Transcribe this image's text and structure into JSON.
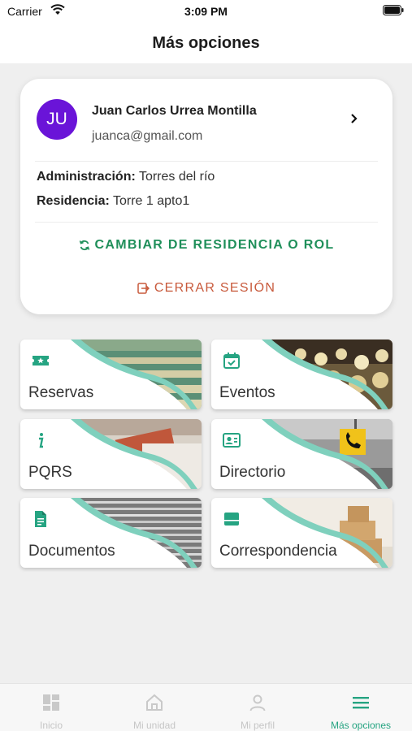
{
  "status_bar": {
    "carrier": "Carrier",
    "time": "3:09 PM"
  },
  "header": {
    "title": "Más opciones"
  },
  "profile": {
    "avatar_initials": "JU",
    "name": "Juan Carlos Urrea Montilla",
    "email": "juanca@gmail.com",
    "admin_label": "Administración:",
    "admin_value": "Torres del río",
    "residence_label": "Residencia:",
    "residence_value": "Torre 1 apto1",
    "change_button": "CAMBIAR DE RESIDENCIA O ROL",
    "logout_button": "CERRAR SESIÓN"
  },
  "tiles": [
    {
      "label": "Reservas",
      "icon": "ticket-star-icon"
    },
    {
      "label": "Eventos",
      "icon": "calendar-check-icon"
    },
    {
      "label": "PQRS",
      "icon": "info-icon"
    },
    {
      "label": "Directorio",
      "icon": "contact-card-icon"
    },
    {
      "label": "Documentos",
      "icon": "document-icon"
    },
    {
      "label": "Correspondencia",
      "icon": "mailbox-icon"
    }
  ],
  "tabbar": {
    "items": [
      {
        "label": "Inicio",
        "icon": "dashboard-icon"
      },
      {
        "label": "Mi unidad",
        "icon": "home-icon"
      },
      {
        "label": "Mi perfil",
        "icon": "person-icon"
      },
      {
        "label": "Más opciones",
        "icon": "menu-icon"
      }
    ],
    "active_index": 3
  },
  "colors": {
    "accent": "#26a482",
    "avatar": "#6a14d8",
    "change_button": "#1f8f5a",
    "logout_button": "#c85a3c"
  }
}
